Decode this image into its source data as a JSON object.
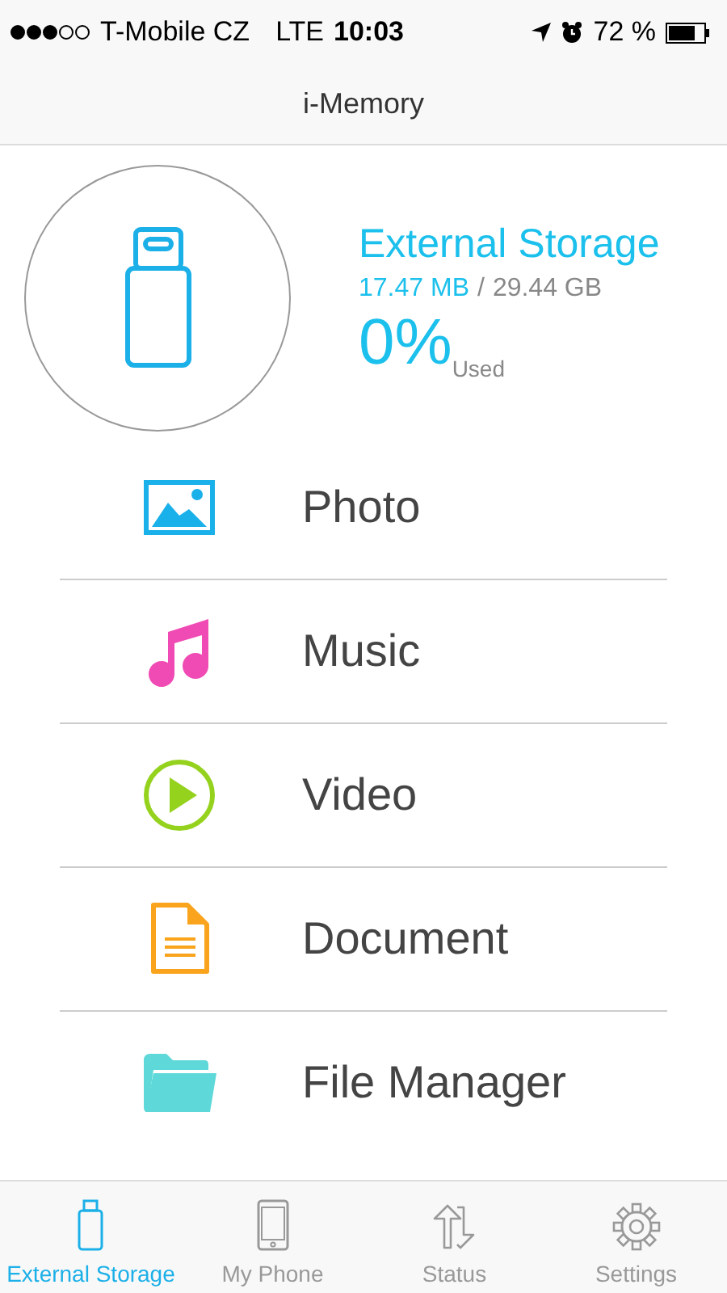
{
  "status_bar": {
    "carrier": "T-Mobile CZ",
    "network": "LTE",
    "time": "10:03",
    "battery": "72 %"
  },
  "nav_bar": {
    "title": "i-Memory"
  },
  "storage": {
    "title": "External Storage",
    "used": "17.47 MB",
    "separator": "/",
    "total": "29.44 GB",
    "percent": "0%",
    "percent_label": "Used"
  },
  "menu": [
    {
      "kind": "photo",
      "label": "Photo",
      "color": "#1ab0ea"
    },
    {
      "kind": "music",
      "label": "Music",
      "color": "#f04bb4"
    },
    {
      "kind": "video",
      "label": "Video",
      "color": "#94d21e"
    },
    {
      "kind": "document",
      "label": "Document",
      "color": "#f9a41c"
    },
    {
      "kind": "folder",
      "label": "File Manager",
      "color": "#5ed8d8"
    }
  ],
  "tabs": [
    {
      "kind": "storage",
      "label": "External Storage",
      "selected": true
    },
    {
      "kind": "phone",
      "label": "My Phone",
      "selected": false
    },
    {
      "kind": "status",
      "label": "Status",
      "selected": false
    },
    {
      "kind": "settings",
      "label": "Settings",
      "selected": false
    }
  ]
}
